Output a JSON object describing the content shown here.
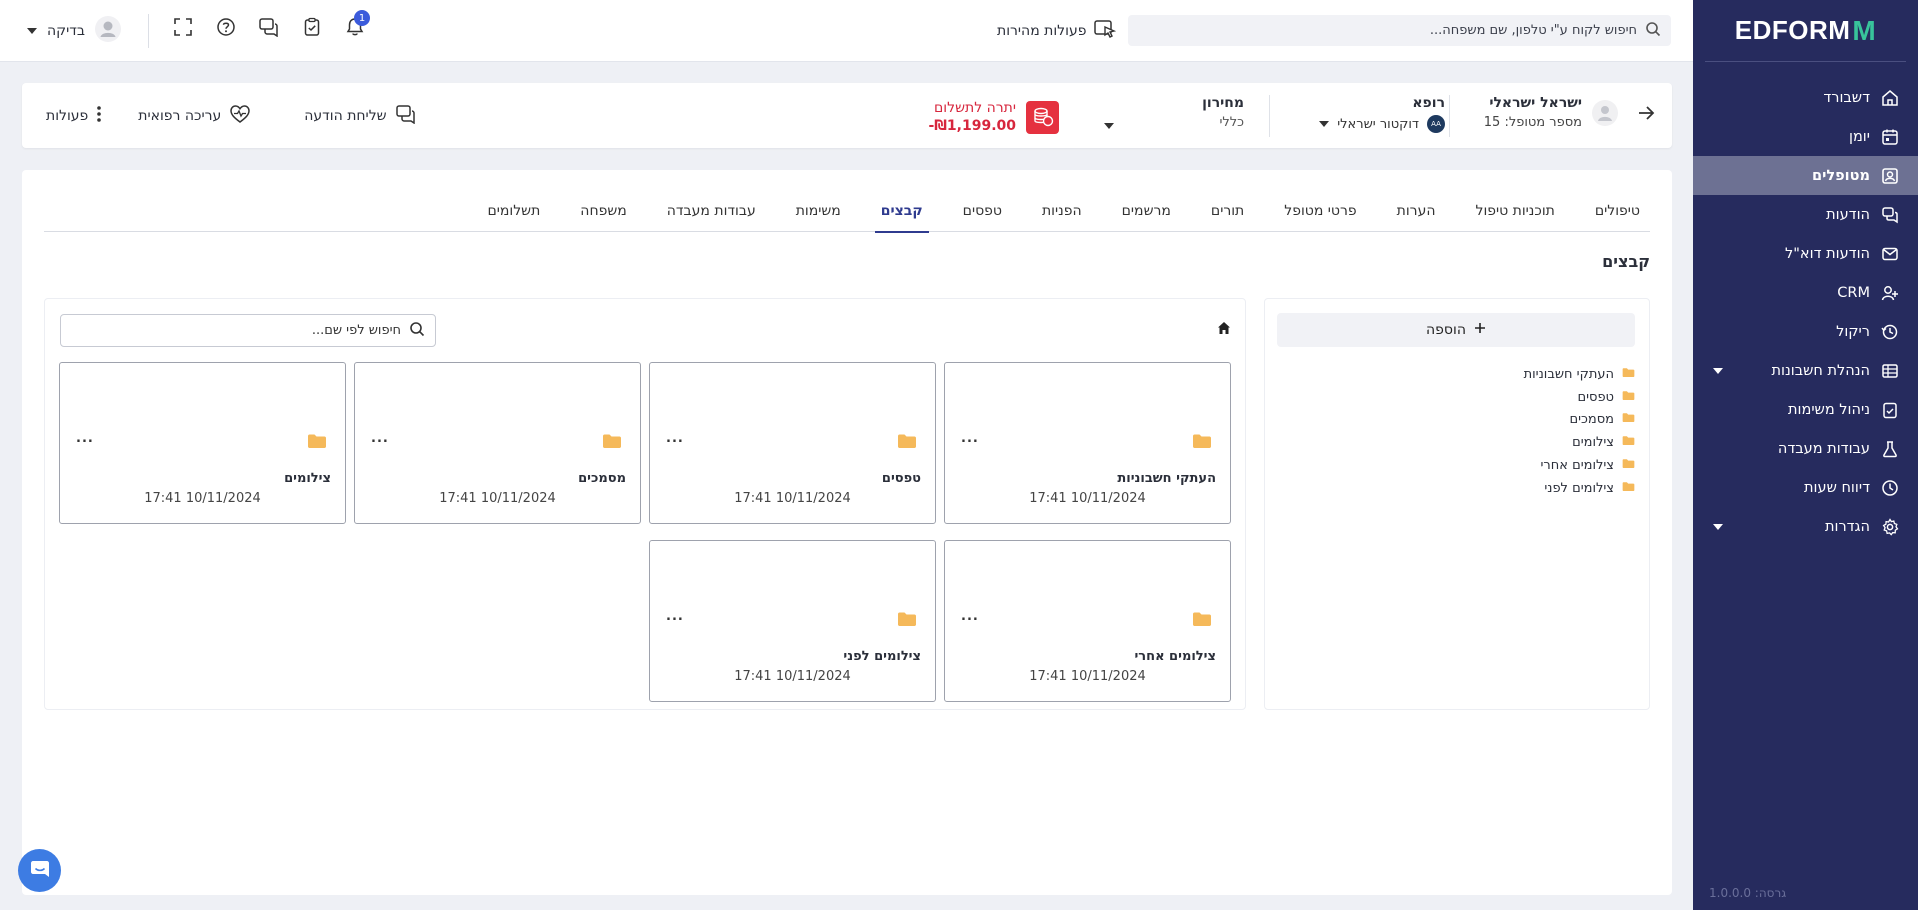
{
  "sidebar": {
    "logo_text": "EDFORM",
    "logo_mark": "M",
    "items": [
      {
        "label": "דשבורד",
        "icon": "home-icon",
        "active": false
      },
      {
        "label": "יומן",
        "icon": "calendar-icon",
        "active": false
      },
      {
        "label": "מטופלים",
        "icon": "patients-icon",
        "active": true
      },
      {
        "label": "הודעות",
        "icon": "messages-icon",
        "active": false
      },
      {
        "label": "הודעות דוא\"ל",
        "icon": "mail-icon",
        "active": false
      },
      {
        "label": "CRM",
        "icon": "crm-icon",
        "active": false
      },
      {
        "label": "ריקול",
        "icon": "recall-icon",
        "active": false
      },
      {
        "label": "הנהלת חשבונות",
        "icon": "accounting-icon",
        "active": false,
        "expandable": true
      },
      {
        "label": "ניהול משימות",
        "icon": "tasks-icon",
        "active": false
      },
      {
        "label": "עבודות מעבדה",
        "icon": "lab-icon",
        "active": false
      },
      {
        "label": "דיווח שעות",
        "icon": "clock-icon",
        "active": false
      },
      {
        "label": "הגדרות",
        "icon": "settings-icon",
        "active": false,
        "expandable": true
      }
    ],
    "version": "גרסה: 1.0.0.0"
  },
  "topbar": {
    "search_placeholder": "חיפוש לקוח ע\"י טלפון, שם משפחה...",
    "quick_actions_label": "פעולות מהירות",
    "notifications_count": "1",
    "user_name": "בדיקה"
  },
  "patient": {
    "name": "ישראל ישראלי",
    "number": "מספר מטופל: 15",
    "doctor_label": "רופא",
    "doctor_value": "דוקטור ישראלי",
    "doctor_initials": "AA",
    "pricelist_label": "מחירון",
    "pricelist_value": "כללי",
    "balance_label": "יתרה לתשלום",
    "balance_amount": "-₪1,199.00",
    "send_message": "שליחת הודעה",
    "medical_edit": "עריכה רפואית",
    "actions": "פעולות"
  },
  "tabs": [
    {
      "label": "טיפולים",
      "active": false
    },
    {
      "label": "תוכניות טיפול",
      "active": false
    },
    {
      "label": "הערות",
      "active": false
    },
    {
      "label": "פרטי מטופל",
      "active": false
    },
    {
      "label": "תורים",
      "active": false
    },
    {
      "label": "מרשמים",
      "active": false
    },
    {
      "label": "הפניות",
      "active": false
    },
    {
      "label": "טפסים",
      "active": false
    },
    {
      "label": "קבצים",
      "active": true
    },
    {
      "label": "משימות",
      "active": false
    },
    {
      "label": "עבודות מעבדה",
      "active": false
    },
    {
      "label": "משפחה",
      "active": false
    },
    {
      "label": "תשלומים",
      "active": false
    }
  ],
  "files": {
    "section_title": "קבצים",
    "add_label": "הוספה",
    "search_placeholder": "חיפוש לפי שם...",
    "tree": [
      "העתקי חשבוניות",
      "טפסים",
      "מסמכים",
      "צילומים",
      "צילומים אחרי",
      "צילומים לפני"
    ],
    "cards": [
      {
        "name": "העתקי חשבוניות",
        "date": "17:41 10/11/2024",
        "more": "..."
      },
      {
        "name": "טפסים",
        "date": "17:41 10/11/2024",
        "more": "..."
      },
      {
        "name": "מסמכים",
        "date": "17:41 10/11/2024",
        "more": "..."
      },
      {
        "name": "צילומים",
        "date": "17:41 10/11/2024",
        "more": "..."
      },
      {
        "name": "צילומים אחרי",
        "date": "17:41 10/11/2024",
        "more": "..."
      },
      {
        "name": "צילומים לפני",
        "date": "17:41 10/11/2024",
        "more": "..."
      }
    ]
  },
  "colors": {
    "sidebar_bg": "#262b5e",
    "accent": "#2f3b8f",
    "folder": "#f5b95a",
    "balance": "#d7263d",
    "chat": "#3d7ce3"
  }
}
